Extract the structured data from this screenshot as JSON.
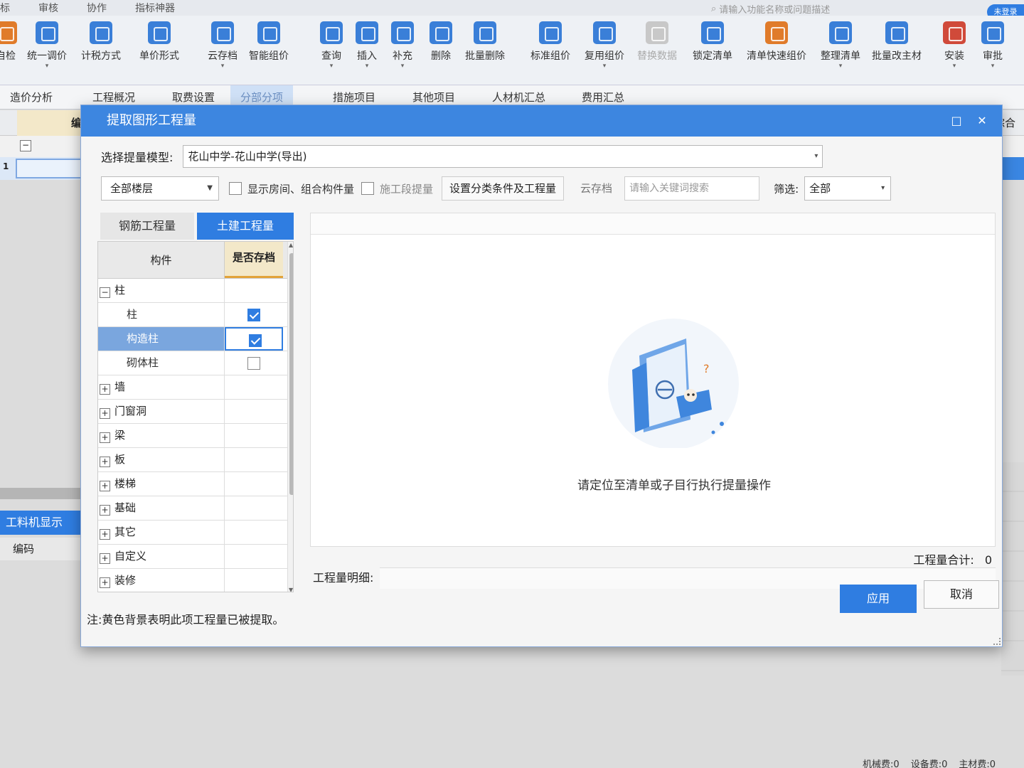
{
  "menu": [
    "标",
    "审核",
    "协作",
    "指标神器"
  ],
  "global_search_placeholder": "请输入功能名称或问题描述",
  "login_label": "未登录",
  "ribbon": [
    {
      "label": "自检",
      "color": "#e07b2a",
      "dd": false
    },
    {
      "label": "统一调价",
      "color": "#3a7fd8",
      "dd": true
    },
    {
      "label": "计税方式",
      "color": "#3a7fd8",
      "dd": false
    },
    {
      "label": "单价形式",
      "color": "#3a7fd8",
      "dd": false
    },
    {
      "label": "云存档",
      "color": "#3a7fd8",
      "dd": true
    },
    {
      "label": "智能组价",
      "color": "#3a7fd8",
      "dd": false
    },
    {
      "label": "查询",
      "color": "#3a7fd8",
      "dd": true
    },
    {
      "label": "插入",
      "color": "#3a7fd8",
      "dd": true
    },
    {
      "label": "补充",
      "color": "#3a7fd8",
      "dd": true
    },
    {
      "label": "删除",
      "color": "#3a7fd8",
      "dd": false
    },
    {
      "label": "批量删除",
      "color": "#3a7fd8",
      "dd": false
    },
    {
      "label": "标准组价",
      "color": "#3a7fd8",
      "dd": false
    },
    {
      "label": "复用组价",
      "color": "#3a7fd8",
      "dd": true
    },
    {
      "label": "替换数据",
      "color": "#b8b8b8",
      "dd": false
    },
    {
      "label": "锁定清单",
      "color": "#3a7fd8",
      "dd": false
    },
    {
      "label": "清单快速组价",
      "color": "#e07b2a",
      "dd": false
    },
    {
      "label": "整理清单",
      "color": "#3a7fd8",
      "dd": true
    },
    {
      "label": "批量改主材",
      "color": "#3a7fd8",
      "dd": false
    },
    {
      "label": "安装",
      "color": "#d04a3a",
      "dd": true
    },
    {
      "label": "审批",
      "color": "#3a7fd8",
      "dd": true
    }
  ],
  "tabs": [
    "造价分析",
    "工程概况",
    "取费设置",
    "分部分项",
    "措施项目",
    "其他项目",
    "人材机汇总",
    "费用汇总"
  ],
  "active_tab": 3,
  "bg": {
    "code_header": "编码",
    "right_header": "综合",
    "row_number": "1",
    "gongliao_label": "工料机显示",
    "bottom_code_header": "编码",
    "status": [
      "机械费:0",
      "设备费:0",
      "主材费:0"
    ]
  },
  "dialog": {
    "title": "提取图形工程量",
    "model_label": "选择提量模型:",
    "model_value": "花山中学-花山中学(导出)",
    "floor_value": "全部楼层",
    "show_rooms_label": "显示房间、组合构件量",
    "construction_stage_label": "施工段提量",
    "set_condition_button": "设置分类条件及工程量",
    "cloud_archive_button": "云存档",
    "keyword_placeholder": "请输入关键词搜索",
    "screen_label": "筛选:",
    "screen_value": "全部",
    "panel_tabs": [
      "钢筋工程量",
      "土建工程量"
    ],
    "active_panel_tab": 1,
    "tree_headers": [
      "构件",
      "是否存档"
    ],
    "tree": [
      {
        "label": "柱",
        "level": 0,
        "expander": "−",
        "check": null,
        "selected": false
      },
      {
        "label": "柱",
        "level": 1,
        "expander": "",
        "check": true,
        "selected": false
      },
      {
        "label": "构造柱",
        "level": 1,
        "expander": "",
        "check": true,
        "selected": true
      },
      {
        "label": "砌体柱",
        "level": 1,
        "expander": "",
        "check": false,
        "selected": false
      },
      {
        "label": "墙",
        "level": 0,
        "expander": "+",
        "check": null,
        "selected": false
      },
      {
        "label": "门窗洞",
        "level": 0,
        "expander": "+",
        "check": null,
        "selected": false
      },
      {
        "label": "梁",
        "level": 0,
        "expander": "+",
        "check": null,
        "selected": false
      },
      {
        "label": "板",
        "level": 0,
        "expander": "+",
        "check": null,
        "selected": false
      },
      {
        "label": "楼梯",
        "level": 0,
        "expander": "+",
        "check": null,
        "selected": false
      },
      {
        "label": "基础",
        "level": 0,
        "expander": "+",
        "check": null,
        "selected": false
      },
      {
        "label": "其它",
        "level": 0,
        "expander": "+",
        "check": null,
        "selected": false
      },
      {
        "label": "自定义",
        "level": 0,
        "expander": "+",
        "check": null,
        "selected": false
      },
      {
        "label": "装修",
        "level": 0,
        "expander": "+",
        "check": null,
        "selected": false
      }
    ],
    "empty_message": "请定位至清单或子目行执行提量操作",
    "total_label": "工程量合计:",
    "total_value": "0",
    "detail_label": "工程量明细:",
    "apply_button": "应用",
    "cancel_button": "取消",
    "note": "注:黄色背景表明此项工程量已被提取。",
    "accent_color": "#2f7de1",
    "extracted_color": "#f3e8c9"
  }
}
